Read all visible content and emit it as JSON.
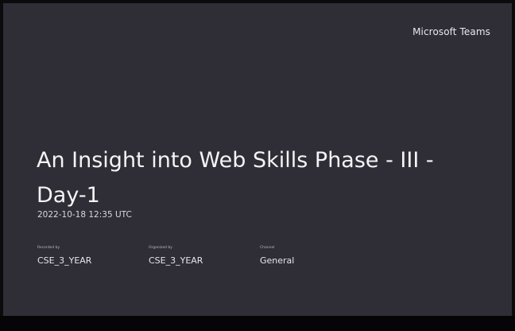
{
  "brand": "Microsoft Teams",
  "recording": {
    "title": "An Insight into Web Skills Phase - III - Day-1",
    "timestamp": "2022-10-18 12:35 UTC"
  },
  "meta": {
    "recorded_by": {
      "label": "Recorded by",
      "value": "CSE_3_YEAR"
    },
    "organized_by": {
      "label": "Organized by",
      "value": "CSE_3_YEAR"
    },
    "channel": {
      "label": "Channel",
      "value": "General"
    }
  },
  "colors": {
    "background": "#2f2e36",
    "text": "#f4f4f6",
    "letterbox": "#050507"
  }
}
